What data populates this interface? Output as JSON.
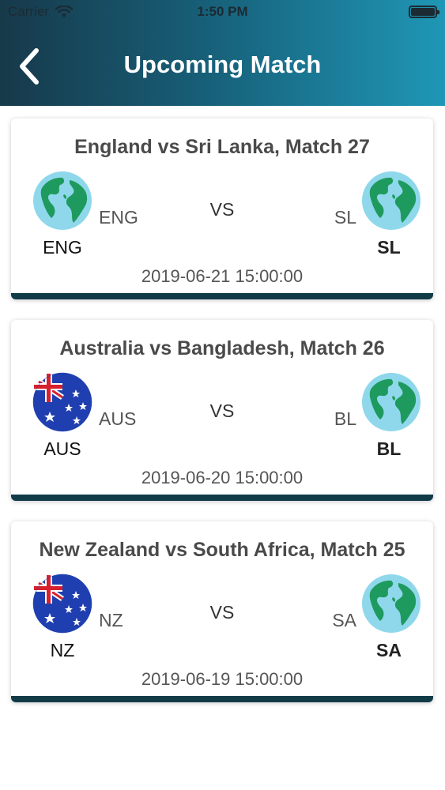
{
  "status_bar": {
    "carrier": "Carrier",
    "time": "1:50 PM"
  },
  "header": {
    "title": "Upcoming Match"
  },
  "matches": [
    {
      "title": "England vs Sri Lanka, Match 27",
      "team1": {
        "code": "ENG",
        "name": "ENG",
        "logo": "globe-icon"
      },
      "team2": {
        "code": "SL",
        "name": "SL",
        "logo": "globe-icon"
      },
      "vs": "VS",
      "datetime": "2019-06-21 15:00:00"
    },
    {
      "title": "Australia vs Bangladesh, Match 26",
      "team1": {
        "code": "AUS",
        "name": "AUS",
        "logo": "australia-flag-icon"
      },
      "team2": {
        "code": "BL",
        "name": "BL",
        "logo": "globe-icon"
      },
      "vs": "VS",
      "datetime": "2019-06-20 15:00:00"
    },
    {
      "title": "New Zealand vs South Africa, Match 25",
      "team1": {
        "code": "NZ",
        "name": "NZ",
        "logo": "australia-flag-icon"
      },
      "team2": {
        "code": "SA",
        "name": "SA",
        "logo": "globe-icon"
      },
      "vs": "VS",
      "datetime": "2019-06-19 15:00:00"
    }
  ],
  "colors": {
    "header_gradient": [
      "#17394a",
      "#1f97b6"
    ],
    "card_bar": "#123b48",
    "ocean": "#8fd8ec",
    "land": "#1f9a5e"
  }
}
